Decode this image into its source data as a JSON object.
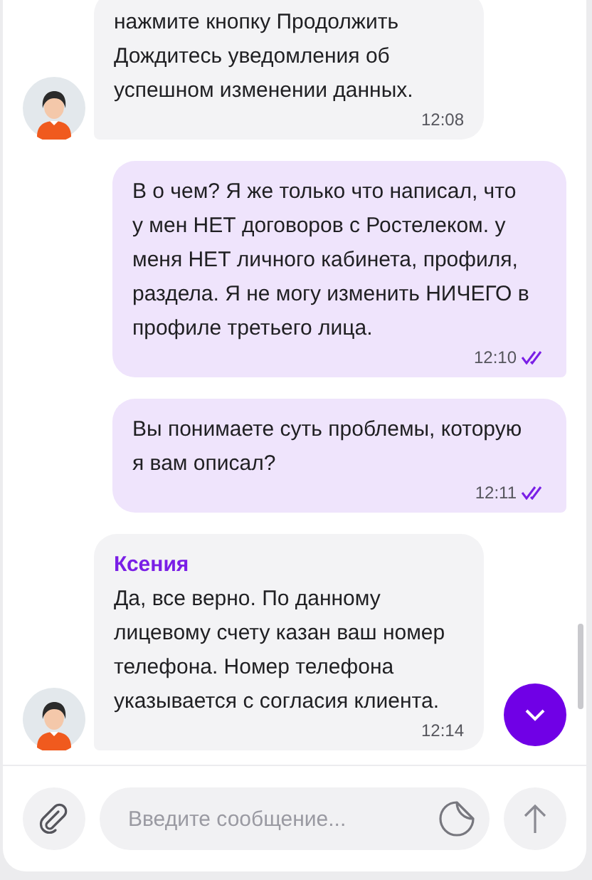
{
  "messages": [
    {
      "kind": "agent",
      "text": "нажмите кнопку Продолжить Дождитесь уведомления об успешном изменении данных.",
      "time": "12:08"
    },
    {
      "kind": "user",
      "text": "В о чем? Я же только что написал, что у мен НЕТ договоров с Ростелеком. у меня НЕТ личного кабинета, профиля, раздела. Я не могу изменить НИЧЕГО в профиле третьего лица.",
      "time": "12:10",
      "read": true
    },
    {
      "kind": "user",
      "text": "Вы понимаете суть проблемы, которую я вам описал?",
      "time": "12:11",
      "read": true
    },
    {
      "kind": "agent",
      "author": "Ксения",
      "text": "Да, все верно. По данному лицевому счету казан ваш номер телефона. Номер телефона указывается с согласия клиента.",
      "time": "12:14"
    }
  ],
  "composer": {
    "placeholder": "Введите сообщение..."
  }
}
